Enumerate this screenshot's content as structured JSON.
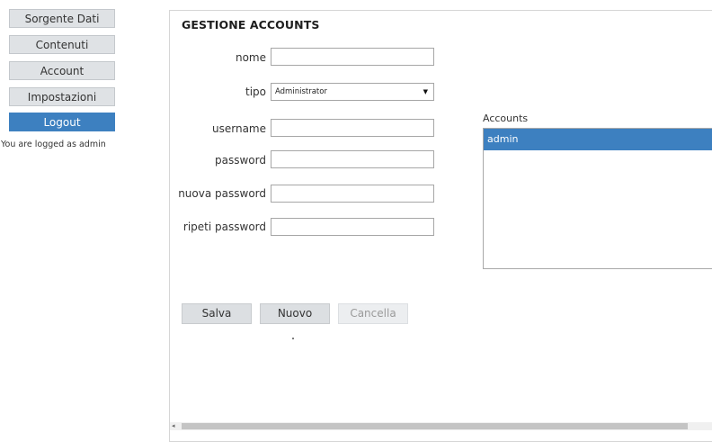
{
  "sidebar": {
    "items": [
      {
        "label": "Sorgente Dati"
      },
      {
        "label": "Contenuti"
      },
      {
        "label": "Account"
      },
      {
        "label": "Impostazioni"
      },
      {
        "label": "Logout"
      }
    ],
    "status": "You are logged as admin"
  },
  "form": {
    "title": "GESTIONE ACCOUNTS",
    "nome_label": "nome",
    "nome_value": "",
    "tipo_label": "tipo",
    "tipo_value": "Administrator",
    "username_label": "username",
    "username_value": "",
    "password_label": "password",
    "password_value": "",
    "nuova_password_label": "nuova password",
    "nuova_password_value": "",
    "ripeti_password_label": "ripeti password",
    "ripeti_password_value": ""
  },
  "accounts": {
    "label": "Accounts",
    "items": [
      "admin"
    ]
  },
  "actions": {
    "save_label": "Salva",
    "new_label": "Nuovo",
    "delete_label": "Cancella"
  },
  "colors": {
    "accent": "#3d80c0",
    "button_bg": "#dfe2e5"
  }
}
